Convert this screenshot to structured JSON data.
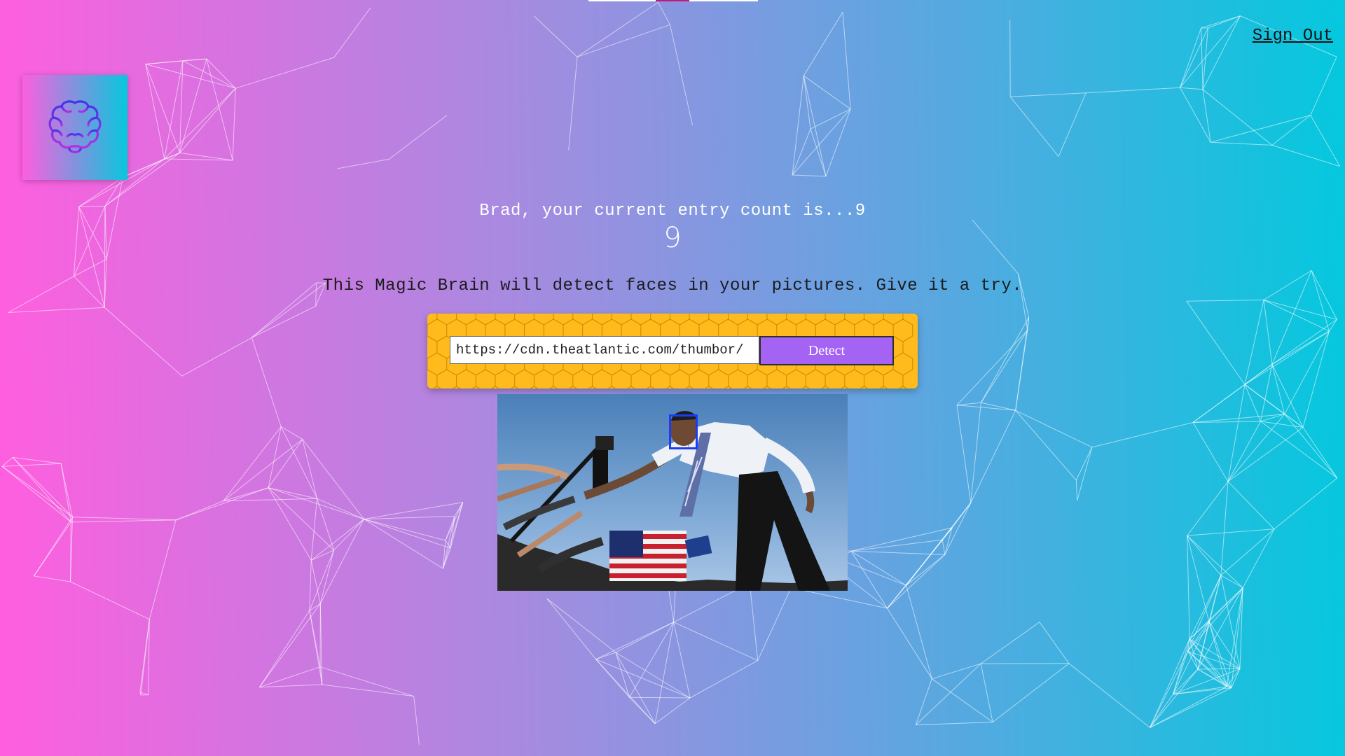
{
  "header": {
    "sign_out_label": "Sign Out"
  },
  "logo": {
    "icon": "brain-icon"
  },
  "rank": {
    "message": "Brad, your current entry count is...9",
    "count": "9"
  },
  "description": "This Magic Brain will detect faces in your pictures. Give it a try.",
  "form": {
    "url_value": "https://cdn.theatlantic.com/thumbor/",
    "button_label": "Detect"
  },
  "result": {
    "image_subject": "photo-of-politician-shaking-hands-with-crowd",
    "face_box_color": "#1b3cf5",
    "faces_detected": 1
  },
  "colors": {
    "gradient_start": "#ff5edf",
    "gradient_end": "#04c8de",
    "detect_button": "#a463f2",
    "form_background": "#ffba1c"
  }
}
